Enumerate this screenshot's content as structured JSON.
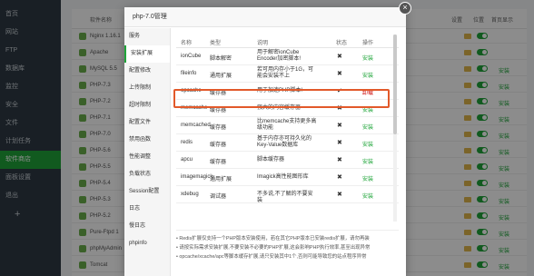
{
  "sidebar": {
    "items": [
      {
        "label": "首页"
      },
      {
        "label": "网站"
      },
      {
        "label": "FTP"
      },
      {
        "label": "数据库"
      },
      {
        "label": "监控"
      },
      {
        "label": "安全"
      },
      {
        "label": "文件"
      },
      {
        "label": "计划任务"
      },
      {
        "label": "软件商店",
        "active": true
      },
      {
        "label": "面板设置"
      },
      {
        "label": "退出"
      }
    ],
    "add_label": "+"
  },
  "background": {
    "headers": {
      "name": "软件名称",
      "settings": "设置",
      "position": "位置",
      "home": "首页显示"
    },
    "rows": [
      {
        "name": "Nginx 1.16.1",
        "action": "",
        "right": ""
      },
      {
        "name": "Apache",
        "action": "",
        "right": ""
      },
      {
        "name": "MySQL 5.5",
        "action": "",
        "right": "安装"
      },
      {
        "name": "PHP-7.3",
        "action": "",
        "right": "安装"
      },
      {
        "name": "PHP-7.2",
        "action": "",
        "right": "安装"
      },
      {
        "name": "PHP-7.1",
        "action": "",
        "right": "安装"
      },
      {
        "name": "PHP-7.0",
        "action": "",
        "right": "安装"
      },
      {
        "name": "PHP-5.6",
        "action": "",
        "right": "安装"
      },
      {
        "name": "PHP-5.5",
        "action": "",
        "right": "安装"
      },
      {
        "name": "PHP-5.4",
        "action": "",
        "right": "安装"
      },
      {
        "name": "PHP-5.3",
        "action": "",
        "right": "安装"
      },
      {
        "name": "PHP-5.2",
        "action": "",
        "right": "安装"
      },
      {
        "name": "Pure-Ftpd 1",
        "action": "",
        "right": "安装"
      },
      {
        "name": "phpMyAdmin",
        "action": "",
        "right": "安装"
      },
      {
        "name": "Tomcat",
        "action": "",
        "right": "安装"
      }
    ]
  },
  "modal": {
    "title": "php-7.0管理",
    "close": "×",
    "menu": [
      {
        "label": "服务"
      },
      {
        "label": "安装扩展",
        "active": true
      },
      {
        "label": "配置修改"
      },
      {
        "label": "上传限制"
      },
      {
        "label": "超时限制"
      },
      {
        "label": "配置文件"
      },
      {
        "label": "禁用函数"
      },
      {
        "label": "性能调整"
      },
      {
        "label": "负载状态"
      },
      {
        "label": "Session配置"
      },
      {
        "label": "日志"
      },
      {
        "label": "慢日志"
      },
      {
        "label": "phpinfo"
      }
    ],
    "table": {
      "headers": {
        "name": "名称",
        "type": "类型",
        "desc": "说明",
        "status": "状态",
        "action": "操作"
      },
      "rows": [
        {
          "name": "ionCube",
          "type": "脚本解密",
          "desc": "用于解密ionCube Encoder加密脚本!",
          "status": "✖",
          "action": "安装",
          "danger": false
        },
        {
          "name": "fileinfo",
          "type": "通用扩展",
          "desc": "若可用内存小于1G，可能会安装不上",
          "status": "✖",
          "action": "安装",
          "danger": false
        },
        {
          "name": "opcache",
          "type": "缓存器",
          "desc": "用于加速PHP脚本!",
          "status": "✔",
          "action": "卸载",
          "danger": true
        },
        {
          "name": "memcache",
          "type": "缓存器",
          "desc": "强大的内容缓存器",
          "status": "✖",
          "action": "安装",
          "danger": false
        },
        {
          "name": "memcached",
          "type": "缓存器",
          "desc": "比memcache支持更多高级功能",
          "status": "✖",
          "action": "安装",
          "danger": false
        },
        {
          "name": "redis",
          "type": "缓存器",
          "desc": "基于内存亦可持久化的Key-Value数据库",
          "status": "✖",
          "action": "安装",
          "danger": false
        },
        {
          "name": "apcu",
          "type": "缓存器",
          "desc": "脚本缓存器",
          "status": "✖",
          "action": "安装",
          "danger": false
        },
        {
          "name": "imagemagick",
          "type": "通用扩展",
          "desc": "Imagick高性能图形库",
          "status": "✖",
          "action": "安装",
          "danger": false
        },
        {
          "name": "xdebug",
          "type": "调试器",
          "desc": "不多说,不了解的不要安装",
          "status": "✖",
          "action": "安装",
          "danger": false
        }
      ]
    },
    "notes": [
      "Redis扩展仅支持一个PHP版本安装使用，若在其它PHP版本已安装redis扩展，请勿再装",
      "请按实际需求安装扩展,不要安装不必要的PHP扩展,这会影响PHP执行效率,甚至出现异常",
      "opcache/xcache/apc等脚本缓存扩展,请只安装其中1个,否则可能导致您的站点程序异常"
    ]
  },
  "colors": {
    "accent": "#20a53a",
    "highlight": "#e2592a",
    "danger": "#cc0000"
  }
}
